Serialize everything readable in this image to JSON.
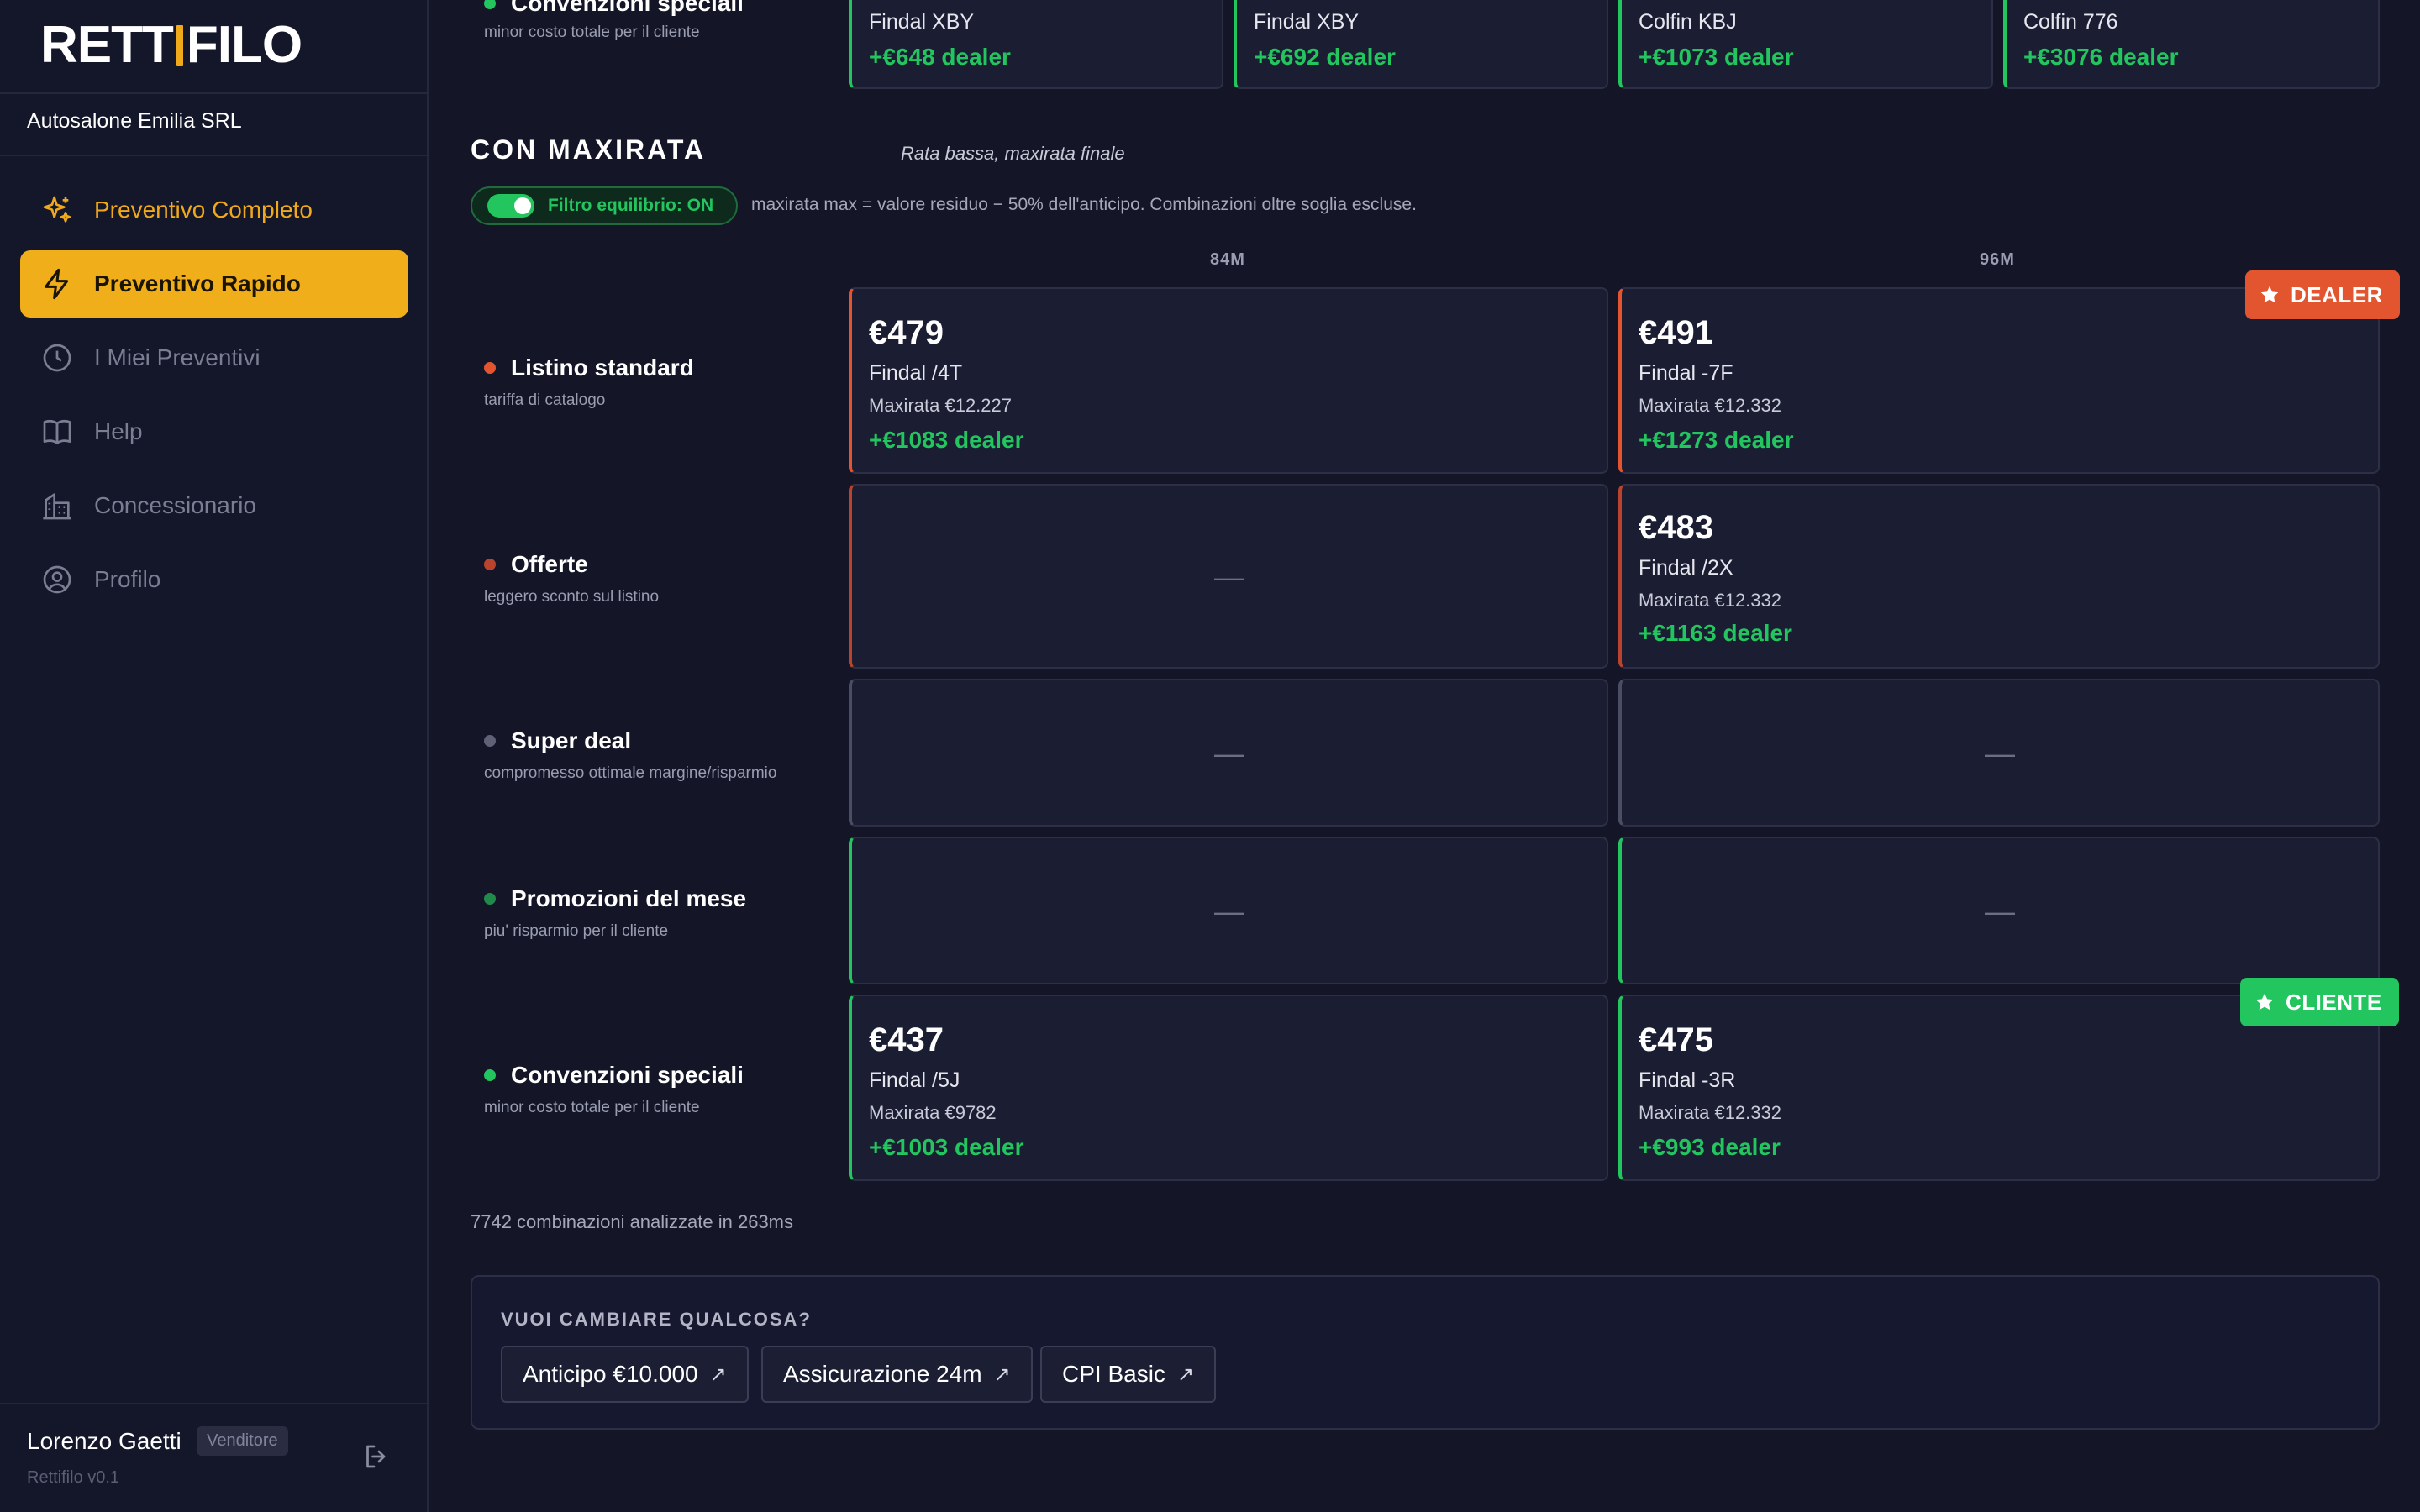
{
  "sidebar": {
    "logo_left": "RETT",
    "logo_right": "FILO",
    "company": "Autosalone Emilia SRL",
    "nav": [
      {
        "label": "Preventivo Completo",
        "icon": "sparkles-icon"
      },
      {
        "label": "Preventivo Rapido",
        "icon": "lightning-icon"
      },
      {
        "label": "I Miei Preventivi",
        "icon": "clock-icon"
      },
      {
        "label": "Help",
        "icon": "book-icon"
      },
      {
        "label": "Concessionario",
        "icon": "building-icon"
      },
      {
        "label": "Profilo",
        "icon": "user-circle-icon"
      }
    ],
    "user": {
      "name": "Lorenzo Gaetti",
      "role": "Venditore"
    },
    "version": "Rettifilo v0.1"
  },
  "top_partial": {
    "label": {
      "title": "Convenzioni speciali",
      "sub": "minor costo totale per il cliente"
    },
    "cards": [
      {
        "code": "Findal XBY",
        "gain": "+€648 dealer"
      },
      {
        "code": "Findal XBY",
        "gain": "+€692 dealer"
      },
      {
        "code": "Colfin KBJ",
        "gain": "+€1073 dealer"
      },
      {
        "code": "Colfin 776",
        "gain": "+€3076 dealer"
      }
    ]
  },
  "section": {
    "title": "CON MAXIRATA",
    "subtitle": "Rata bassa, maxirata finale",
    "toggle_label": "Filtro equilibrio: ON",
    "toggle_on": true,
    "note": "maxirata max = valore residuo − 50% dell'anticipo. Combinazioni oltre soglia escluse.",
    "columns": [
      "84M",
      "96M"
    ],
    "badges": {
      "dealer": "DEALER",
      "cliente": "CLIENTE"
    },
    "empty_symbol": "—",
    "rows": [
      {
        "title": "Listino standard",
        "sub": "tariffa di catalogo",
        "dot": "#e3552f",
        "cells": [
          {
            "price": "€479",
            "code": "Findal /4T",
            "maxi": "Maxirata €12.227",
            "gain": "+€1083 dealer"
          },
          {
            "price": "€491",
            "code": "Findal -7F",
            "maxi": "Maxirata €12.332",
            "gain": "+€1273 dealer"
          }
        ]
      },
      {
        "title": "Offerte",
        "sub": "leggero sconto sul listino",
        "dot": "#b9432d",
        "cells": [
          null,
          {
            "price": "€483",
            "code": "Findal /2X",
            "maxi": "Maxirata €12.332",
            "gain": "+€1163 dealer"
          }
        ]
      },
      {
        "title": "Super deal",
        "sub": "compromesso ottimale margine/risparmio",
        "dot": "#5f6276",
        "cells": [
          null,
          null
        ]
      },
      {
        "title": "Promozioni del mese",
        "sub": "piu' risparmio per il cliente",
        "dot": "#1f8a4a",
        "cells": [
          null,
          null
        ]
      },
      {
        "title": "Convenzioni speciali",
        "sub": "minor costo totale per il cliente",
        "dot": "#22c55e",
        "cells": [
          {
            "price": "€437",
            "code": "Findal /5J",
            "maxi": "Maxirata €9782",
            "gain": "+€1003 dealer"
          },
          {
            "price": "€475",
            "code": "Findal -3R",
            "maxi": "Maxirata €12.332",
            "gain": "+€993 dealer"
          }
        ]
      }
    ]
  },
  "combo_text": "7742 combinazioni analizzate in 263ms",
  "change": {
    "title": "VUOI CAMBIARE QUALCOSA?",
    "buttons": [
      "Anticipo €10.000",
      "Assicurazione 24m",
      "CPI Basic"
    ],
    "arrow": "↗"
  },
  "colors": {
    "accent": "#f0ae1b",
    "dealer": "#e3552f",
    "cliente": "#22c55e",
    "background": "#141628"
  }
}
